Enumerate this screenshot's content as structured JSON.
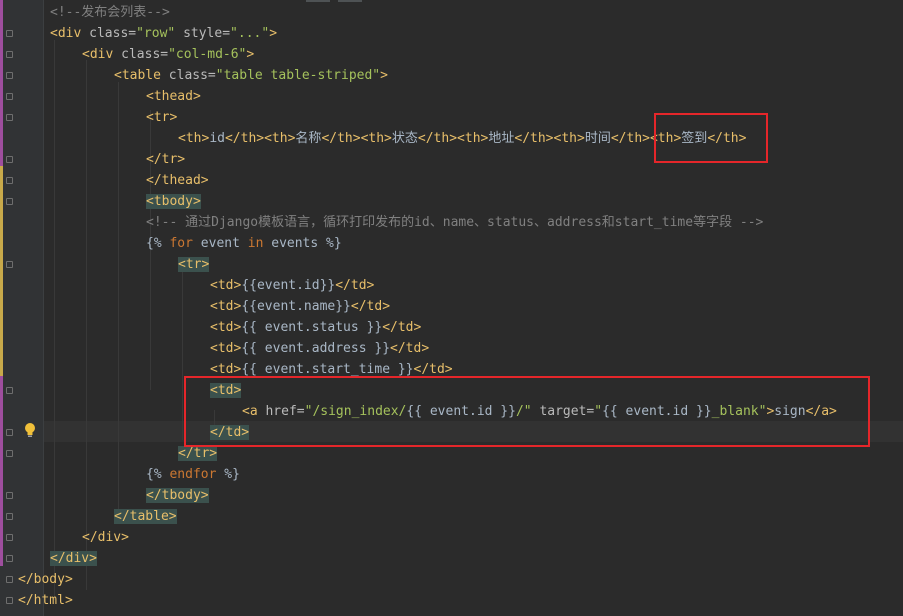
{
  "editor": {
    "lines": [
      [
        [
          "cmt",
          "<!--发布会列表-->"
        ]
      ],
      [
        [
          "tag",
          "<div "
        ],
        [
          "attr",
          "class="
        ],
        [
          "str",
          "\"row\" "
        ],
        [
          "attr",
          "style="
        ],
        [
          "str",
          "\"...\""
        ],
        [
          "tag",
          ">"
        ]
      ],
      [
        [
          "tag",
          "<div "
        ],
        [
          "attr",
          "class="
        ],
        [
          "str",
          "\"col-md-6\""
        ],
        [
          "tag",
          ">"
        ]
      ],
      [
        [
          "tag",
          "<table "
        ],
        [
          "attr",
          "class="
        ],
        [
          "str",
          "\"table table-striped\""
        ],
        [
          "tag",
          ">"
        ]
      ],
      [
        [
          "tag",
          "<thead>"
        ]
      ],
      [
        [
          "tag",
          "<tr>"
        ]
      ],
      [
        [
          "tag",
          "<th>"
        ],
        [
          "tpl",
          "id"
        ],
        [
          "tag",
          "</th><th>"
        ],
        [
          "tpl",
          "名称"
        ],
        [
          "tag",
          "</th><th>"
        ],
        [
          "tpl",
          "状态"
        ],
        [
          "tag",
          "</th><th>"
        ],
        [
          "tpl",
          "地址"
        ],
        [
          "tag",
          "</th><th>"
        ],
        [
          "tpl",
          "时间"
        ],
        [
          "tag",
          "</th><th>"
        ],
        [
          "tpl",
          "签到"
        ],
        [
          "tag",
          "</th>"
        ]
      ],
      [
        [
          "tag",
          "</tr>"
        ]
      ],
      [
        [
          "tag",
          "</thead>"
        ]
      ],
      [
        [
          "tag",
          "<tbody>"
        ]
      ],
      [
        [
          "cmt",
          "<!-- 通过Django模板语言，循环打印发布的id、name、status、address和start_time等字段 -->"
        ]
      ],
      [
        [
          "tpl",
          "{% "
        ],
        [
          "kw",
          "for "
        ],
        [
          "tpl",
          "event "
        ],
        [
          "kw",
          "in "
        ],
        [
          "tpl",
          "events %}"
        ]
      ],
      [
        [
          "tag",
          "<tr>"
        ]
      ],
      [
        [
          "tag",
          "<td>"
        ],
        [
          "tpl",
          "{{event.id}}"
        ],
        [
          "tag",
          "</td>"
        ]
      ],
      [
        [
          "tag",
          "<td>"
        ],
        [
          "tpl",
          "{{event.name}}"
        ],
        [
          "tag",
          "</td>"
        ]
      ],
      [
        [
          "tag",
          "<td>"
        ],
        [
          "tpl",
          "{{ event.status }}"
        ],
        [
          "tag",
          "</td>"
        ]
      ],
      [
        [
          "tag",
          "<td>"
        ],
        [
          "tpl",
          "{{ event.address }}"
        ],
        [
          "tag",
          "</td>"
        ]
      ],
      [
        [
          "tag",
          "<td>"
        ],
        [
          "tpl",
          "{{ event.start_time }}"
        ],
        [
          "tag",
          "</td>"
        ]
      ],
      [
        [
          "tag",
          "<td>"
        ]
      ],
      [
        [
          "tag",
          "<a "
        ],
        [
          "attr",
          "href="
        ],
        [
          "str",
          "\"/sign_index/"
        ],
        [
          "tpl",
          "{{ event.id }}"
        ],
        [
          "str",
          "/\" "
        ],
        [
          "attr",
          "target="
        ],
        [
          "str",
          "\""
        ],
        [
          "tpl",
          "{{ event.id }}"
        ],
        [
          "str",
          "_blank\""
        ],
        [
          "tag",
          ">"
        ],
        [
          "tpl",
          "sign"
        ],
        [
          "tag",
          "</a>"
        ]
      ],
      [
        [
          "tag",
          "</td>"
        ]
      ],
      [
        [
          "tag",
          "</tr>"
        ]
      ],
      [
        [
          "tpl",
          "{% "
        ],
        [
          "kw",
          "endfor "
        ],
        [
          "tpl",
          "%}"
        ]
      ],
      [
        [
          "tag",
          "</tbody>"
        ]
      ],
      [
        [
          "tag",
          "</table>"
        ]
      ],
      [
        [
          "tag",
          "</div>"
        ]
      ],
      [
        [
          "tag",
          "</div>"
        ]
      ],
      [
        [
          "tag",
          "</body>"
        ]
      ],
      [
        [
          "tag",
          "</html>"
        ]
      ]
    ]
  },
  "colors": {
    "background": "#2b2b2b",
    "gutter": "#313335",
    "tag": "#e8bf6a",
    "attribute": "#bababa",
    "string": "#a5c25c",
    "comment": "#808080",
    "keyword": "#cc7832",
    "annotation_box": "#e5262a"
  },
  "icons": {
    "gutter_hint": "lightbulb-icon",
    "fold_marker": "fold-marker-icon"
  }
}
